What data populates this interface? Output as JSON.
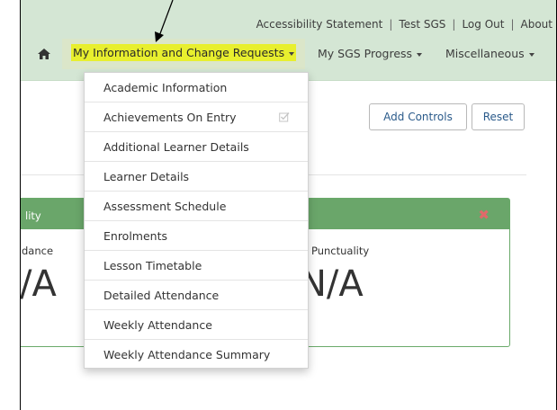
{
  "header": {
    "top_links": [
      "Accessibility Statement",
      "Test SGS",
      "Log Out",
      "About"
    ],
    "separator": "|",
    "nav": {
      "home_icon": "home-icon",
      "active_item": "My Information and Change Requests",
      "items": [
        "My SGS Progress",
        "Miscellaneous"
      ]
    }
  },
  "dropdown": {
    "items": [
      "Academic Information",
      "Achievements On Entry",
      "Additional Learner Details",
      "Learner Details",
      "Assessment Schedule",
      "Enrolments",
      "Lesson Timetable",
      "Detailed Attendance",
      "Weekly Attendance",
      "Weekly Attendance Summary"
    ],
    "check_icon_item": "Achievements On Entry"
  },
  "toolbar": {
    "add_controls_label": "Add Controls",
    "reset_label": "Reset"
  },
  "panel": {
    "title_fragment": "lity",
    "close_icon": "close-icon",
    "metrics": [
      {
        "label": "dance",
        "value": "/A"
      },
      {
        "label": "Punctuality",
        "value": "N/A",
        "icon": "clock-icon"
      }
    ]
  },
  "colors": {
    "header_bg": "#d4e6d4",
    "highlight": "#e8ef2e",
    "panel_header": "#6aa66a",
    "close": "#e06a6a",
    "link": "#2a5a8a"
  }
}
